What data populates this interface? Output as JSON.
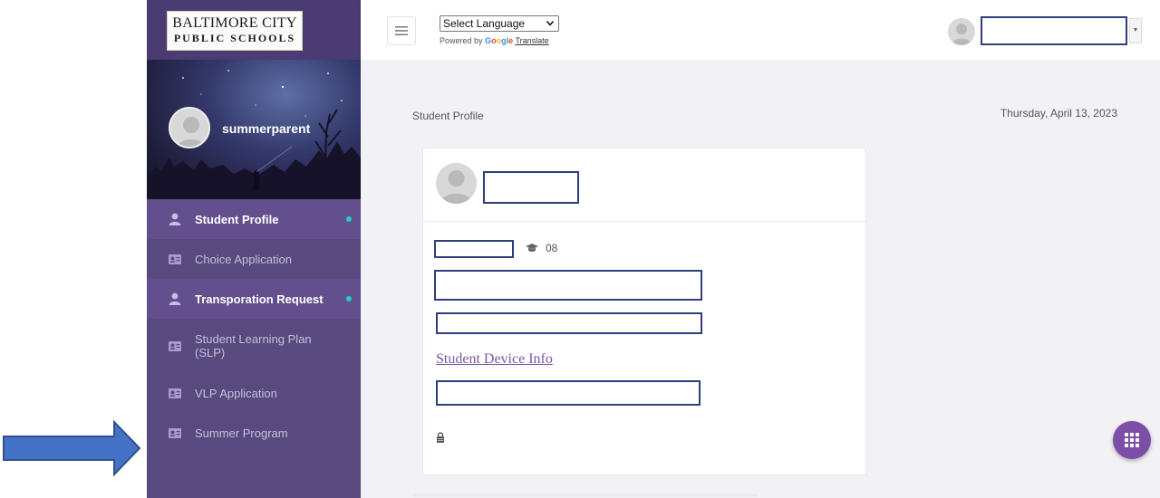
{
  "app": {
    "logo_line1": "BALTIMORE CITY",
    "logo_line2": "PUBLIC SCHOOLS"
  },
  "user": {
    "name": "summerparent"
  },
  "sidebar": {
    "items": [
      {
        "label": "Student Profile",
        "icon": "user-icon",
        "active": true
      },
      {
        "label": "Choice Application",
        "icon": "id-card-icon",
        "active": false
      },
      {
        "label": "Transporation Request",
        "icon": "user-icon",
        "active": true
      },
      {
        "label": "Student Learning Plan (SLP)",
        "icon": "id-card-icon",
        "active": false
      },
      {
        "label": "VLP Application",
        "icon": "id-card-icon",
        "active": false
      },
      {
        "label": "Summer Program",
        "icon": "id-card-icon",
        "active": false
      }
    ]
  },
  "topbar": {
    "language_select": "Select Language",
    "powered_by": "Powered by",
    "google": [
      "G",
      "o",
      "o",
      "g",
      "l",
      "e"
    ],
    "translate": "Translate"
  },
  "main": {
    "title": "Student Profile",
    "date": "Thursday, April 13, 2023",
    "grade": "08",
    "device_link": "Student Device Info"
  },
  "colors": {
    "sidebar": "#58497f",
    "sidebar_active": "#634f8e",
    "dot": "#1ecbd1",
    "redaction_border": "#2f3f7a",
    "link": "#7a55a8",
    "fab": "#7b4fa6",
    "arrow": "#4472c4"
  }
}
